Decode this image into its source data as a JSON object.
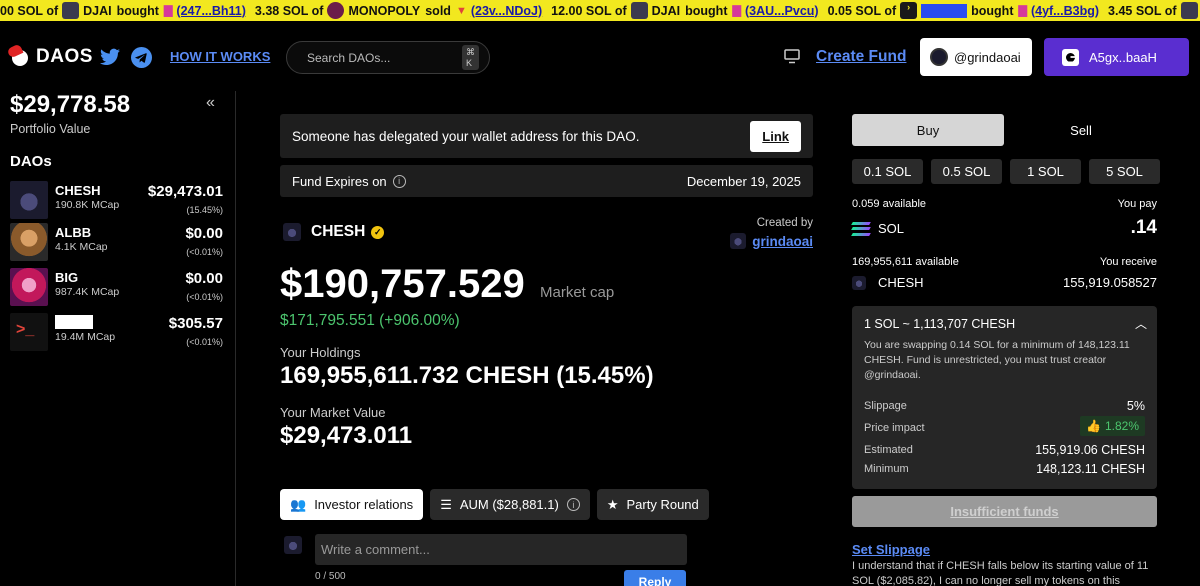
{
  "ticker": [
    {
      "amount": "00 SOL of",
      "avatar_color": "#3b3b4f",
      "token": "DJAI",
      "action": "bought",
      "action_icon": "shopping-bag-icon",
      "address": "(247...Bh11)"
    },
    {
      "amount": "3.38 SOL of",
      "avatar_color": "#6b1d4a",
      "token": "MONOPOLY",
      "action": "sold",
      "action_icon": "down-arrow-icon",
      "address": "(23v...NDoJ)"
    },
    {
      "amount": "12.00 SOL of",
      "avatar_color": "#3b3b4f",
      "token": "DJAI",
      "action": "bought",
      "action_icon": "shopping-bag-icon",
      "address": "(3AU...Pvcu)"
    },
    {
      "amount": "0.05 SOL of",
      "avatar_color": "#1a1a1a",
      "token": "",
      "action": "bought",
      "action_icon": "shopping-bag-icon",
      "address": "(4yf...B3bg)"
    },
    {
      "amount": "3.45 SOL of",
      "avatar_color": "#3b3b4f",
      "token": "",
      "action": "",
      "action_icon": "",
      "address": ""
    }
  ],
  "header": {
    "logo": "DAOS",
    "how_it_works": "HOW IT WORKS",
    "search_placeholder": "Search DAOs...",
    "search_shortcut": "⌘ K",
    "create_fund": "Create Fund",
    "username": "@grindaoai",
    "wallet": "A5gx..baaH"
  },
  "sidebar": {
    "portfolio_value": "$29,778.58",
    "portfolio_label": "Portfolio Value",
    "collapse": "«",
    "daos_title": "DAOs",
    "daos": [
      {
        "name": "CHESH",
        "mcap": "190.8K MCap",
        "value": "$29,473.01",
        "pct": "(15.45%)",
        "thumb_color": "#1b1b2e"
      },
      {
        "name": "ALBB",
        "mcap": "4.1K MCap",
        "value": "$0.00",
        "pct": "(<0.01%)",
        "thumb_color": "#8a5a2b"
      },
      {
        "name": "BIG",
        "mcap": "987.4K MCap",
        "value": "$0.00",
        "pct": "(<0.01%)",
        "thumb_color": "#c2185b"
      },
      {
        "name": "",
        "mcap": "19.4M MCap",
        "value": "$305.57",
        "pct": "(<0.01%)",
        "thumb_color": "#111111"
      }
    ]
  },
  "main": {
    "notice": "Someone has delegated your wallet address for this DAO.",
    "link_label": "Link",
    "expires_label": "Fund Expires on",
    "expires_date": "December 19, 2025",
    "token_name": "CHESH",
    "created_by_label": "Created by",
    "creator": "grindaoai",
    "market_cap": "$190,757.529",
    "market_cap_label": "Market cap",
    "change": "$171,795.551 (+906.00%)",
    "holdings_label": "Your Holdings",
    "holdings": "169,955,611.732 CHESH (15.45%)",
    "market_value_label": "Your Market Value",
    "market_value": "$29,473.011",
    "tabs": [
      "Investor relations",
      "AUM ($28,881.1)",
      "Party Round"
    ],
    "comment_placeholder": "Write a comment...",
    "char_count": "0 / 500",
    "reply": "Reply"
  },
  "trade": {
    "buy": "Buy",
    "sell": "Sell",
    "amounts": [
      "0.1 SOL",
      "0.5 SOL",
      "1 SOL",
      "5 SOL"
    ],
    "sol_available": "0.059 available",
    "you_pay": "You pay",
    "pay_token": "SOL",
    "pay_amount": ".14",
    "chesh_available": "169,955,611 available",
    "you_receive": "You receive",
    "recv_token": "CHESH",
    "recv_amount": "155,919.058527",
    "rate": "1 SOL ~ 1,113,707 CHESH",
    "description": "You are swapping 0.14 SOL for a minimum of 148,123.11 CHESH. Fund is unrestricted, you must trust creator @grindaoai.",
    "slippage_label": "Slippage",
    "slippage": "5%",
    "impact_label": "Price impact",
    "impact": "1.82%",
    "estimated_label": "Estimated",
    "estimated": "155,919.06 CHESH",
    "minimum_label": "Minimum",
    "minimum": "148,123.11 CHESH",
    "insufficient": "Insufficient funds",
    "set_slippage": "Set Slippage",
    "disclaimer": "I understand that if CHESH falls below its starting value of 11 SOL ($2,085.82), I can no longer sell my tokens on this"
  },
  "colors": {
    "accent_link": "#5b8bf5",
    "wallet_purple": "#5a2ed0",
    "ticker_yellow": "#f2e81f",
    "positive_green": "#4cc56e"
  }
}
